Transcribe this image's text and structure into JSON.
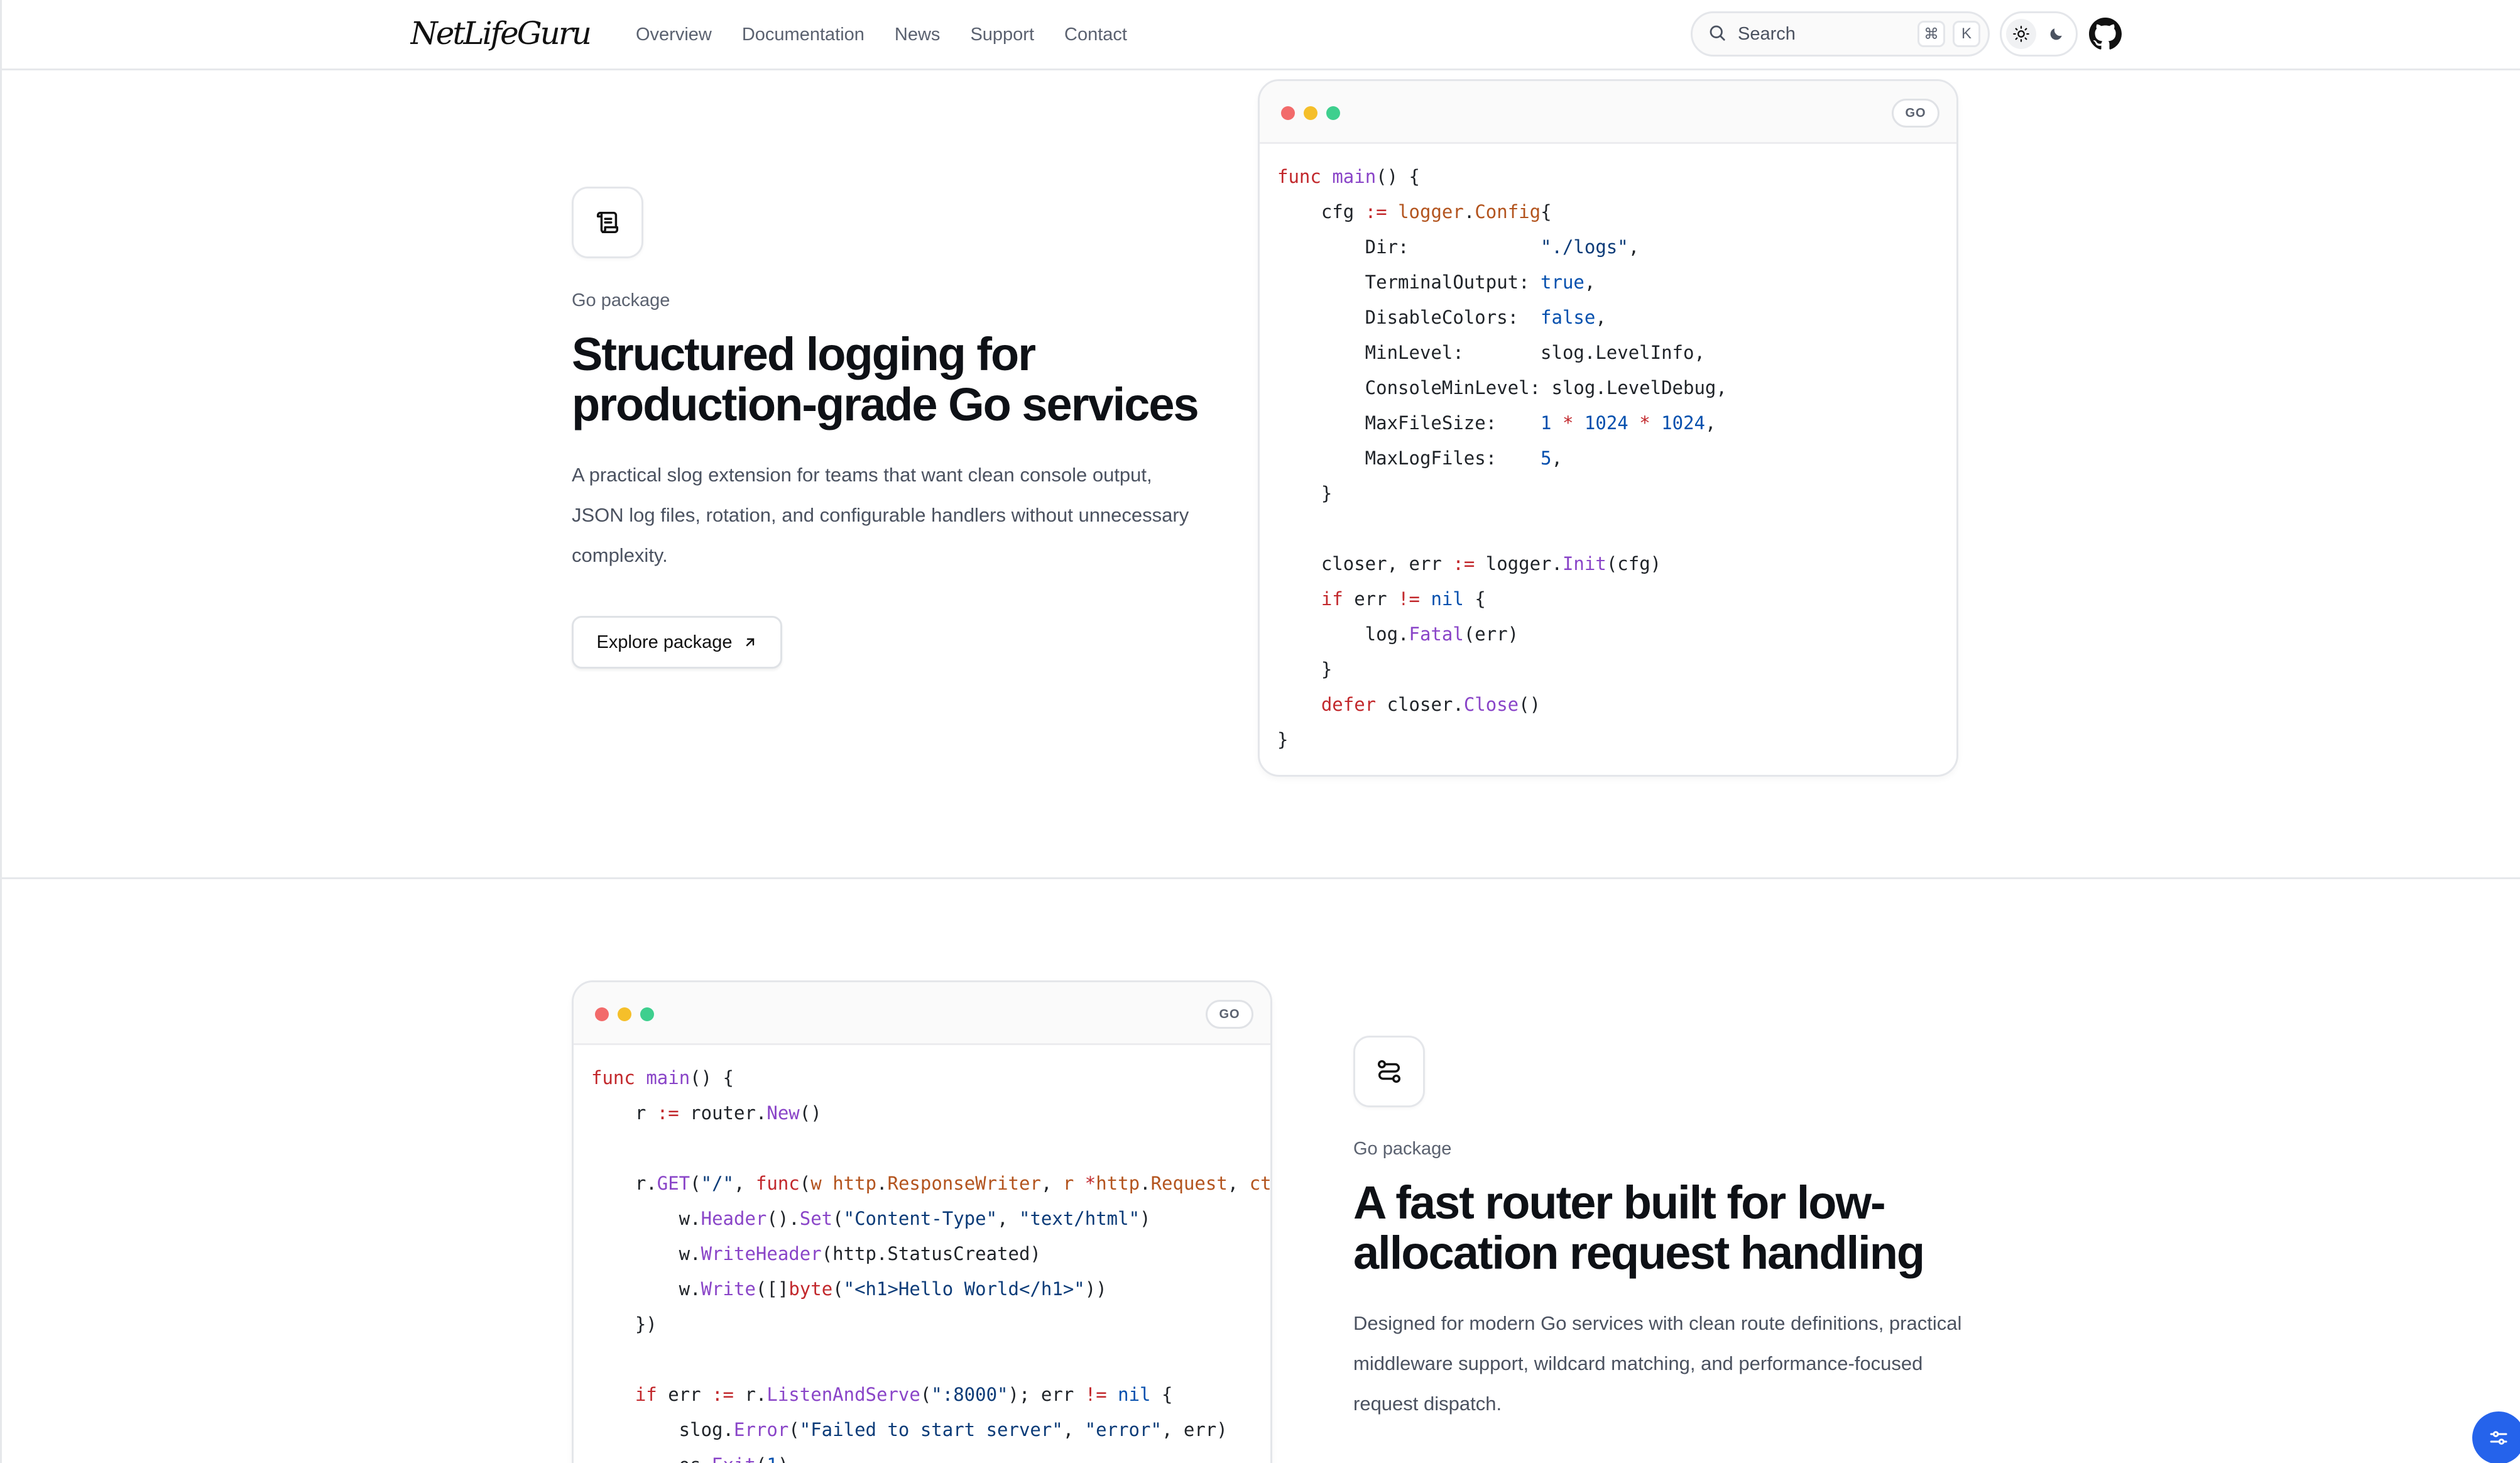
{
  "header": {
    "logo_text": "NetLifeGuru",
    "nav": [
      {
        "label": "Overview"
      },
      {
        "label": "Documentation"
      },
      {
        "label": "News"
      },
      {
        "label": "Support"
      },
      {
        "label": "Contact"
      }
    ],
    "search": {
      "placeholder": "Search",
      "shortcut_mod": "⌘",
      "shortcut_key": "K"
    },
    "theme": {
      "active": "light"
    }
  },
  "section1": {
    "eyebrow": "Go package",
    "title": "Structured logging for production-grade Go services",
    "description": "A practical slog extension for teams that want clean console output, JSON log files, rotation, and configurable handlers without unnecessary complexity.",
    "button_label": "Explore package",
    "code_lang": "GO",
    "icon": "scroll-icon"
  },
  "section2": {
    "eyebrow": "Go package",
    "title": "A fast router built for low-allocation request handling",
    "description": "Designed for modern Go services with clean route definitions, practical middleware support, wildcard matching, and performance-focused request dispatch.",
    "code_lang": "GO",
    "icon": "route-icon"
  },
  "colors": {
    "accent": "#2563eb",
    "dot_red": "#f26b6b",
    "dot_yellow": "#f5bf2a",
    "dot_green": "#3ecf8e"
  }
}
